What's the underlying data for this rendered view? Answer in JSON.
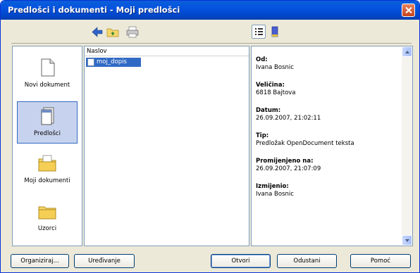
{
  "window": {
    "title": "Predlošci i dokumenti - Moji predlošci"
  },
  "nav": {
    "items": [
      {
        "label": "Novi dokument"
      },
      {
        "label": "Predlošci"
      },
      {
        "label": "Moji dokumenti"
      },
      {
        "label": "Uzorci"
      }
    ],
    "selected": "Predlošci"
  },
  "list": {
    "column": "Naslov",
    "rows": [
      {
        "name": "moj_dopis"
      }
    ]
  },
  "properties": [
    {
      "label": "Od:",
      "value": "Ivana Bosnic"
    },
    {
      "label": "Veličina:",
      "value": "6818 Bajtova"
    },
    {
      "label": "Datum:",
      "value": "26.09.2007, 21:02:11"
    },
    {
      "label": "Tip:",
      "value": "Predložak OpenDocument teksta"
    },
    {
      "label": "Promijenjeno na:",
      "value": "26.09.2007, 21:07:09"
    },
    {
      "label": "Izmijenio:",
      "value": "Ivana Bosnic"
    }
  ],
  "buttons": {
    "organize": "Organiziraj...",
    "edit": "Uređivanje",
    "open": "Otvori",
    "cancel": "Odustani",
    "help": "Pomoć"
  },
  "colors": {
    "titlebar": "#0553e0",
    "selection": "#316ac5",
    "dialog": "#ece9d8"
  }
}
